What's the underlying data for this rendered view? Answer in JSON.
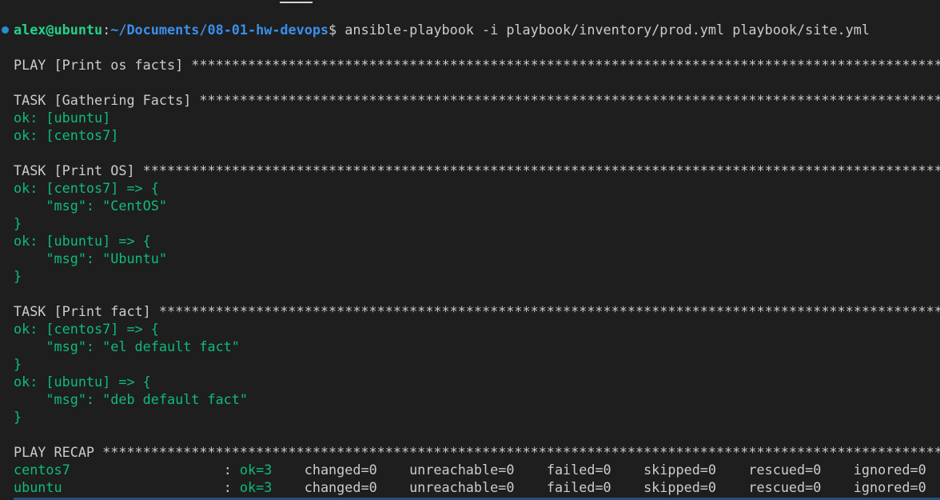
{
  "prompt": {
    "user_host": "alex@ubuntu",
    "colon": ":",
    "path": "~/Documents/08-01-hw-devops",
    "dollar": "$",
    "command": " ansible-playbook -i playbook/inventory/prod.yml playbook/site.yml"
  },
  "output": {
    "play_header": "PLAY [Print os facts] ************************************************************************************************************************************",
    "task_gather_header": "TASK [Gathering Facts] *******************************************************************************************************************************",
    "gather_ok_ubuntu": "ok: [ubuntu]",
    "gather_ok_centos7": "ok: [centos7]",
    "task_print_os_header": "TASK [Print OS] **************************************************************************************************************************************",
    "os_centos_open": "ok: [centos7] => {",
    "os_centos_msg": "    \"msg\": \"CentOS\"",
    "os_centos_close": "}",
    "os_ubuntu_open": "ok: [ubuntu] => {",
    "os_ubuntu_msg": "    \"msg\": \"Ubuntu\"",
    "os_ubuntu_close": "}",
    "task_print_fact_header": "TASK [Print fact] ************************************************************************************************************************************",
    "fact_centos_open": "ok: [centos7] => {",
    "fact_centos_msg": "    \"msg\": \"el default fact\"",
    "fact_centos_close": "}",
    "fact_ubuntu_open": "ok: [ubuntu] => {",
    "fact_ubuntu_msg": "    \"msg\": \"deb default fact\"",
    "fact_ubuntu_close": "}",
    "recap_header": "PLAY RECAP ***********************************************************************************************************************************************"
  },
  "recap": [
    {
      "host": "centos7                   ",
      "sep": ": ",
      "ok": "ok=3",
      "rest": "    changed=0    unreachable=0    failed=0    skipped=0    rescued=0    ignored=0"
    },
    {
      "host": "ubuntu                    ",
      "sep": ": ",
      "ok": "ok=3",
      "rest": "    changed=0    unreachable=0    failed=0    skipped=0    rescued=0    ignored=0"
    }
  ],
  "colors": {
    "background": "#1e1e1e",
    "text": "#cccccc",
    "ok_green": "#0dbc79",
    "user_green": "#23d18b",
    "path_blue": "#3b8eea"
  }
}
